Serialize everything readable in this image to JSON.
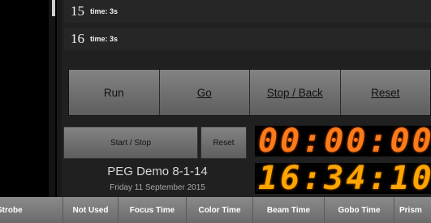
{
  "cue_list": [
    {
      "number": "15",
      "time": "time: 3s"
    },
    {
      "number": "16",
      "time": "time: 3s"
    }
  ],
  "transport": {
    "run": "Run",
    "go": "Go",
    "stop_back": "Stop / Back",
    "reset": "Reset"
  },
  "timer": {
    "start_stop": "Start / Stop",
    "reset": "Reset",
    "elapsed_display": "00:00:00",
    "clock_display": "16:34:10"
  },
  "show": {
    "name": "PEG Demo 8-1-14",
    "date": "Friday 11 September  2015"
  },
  "bottom_tabs": [
    "Strobe",
    "Not Used",
    "Focus Time",
    "Color Time",
    "Beam Time",
    "Gobo Time",
    "Prism"
  ]
}
